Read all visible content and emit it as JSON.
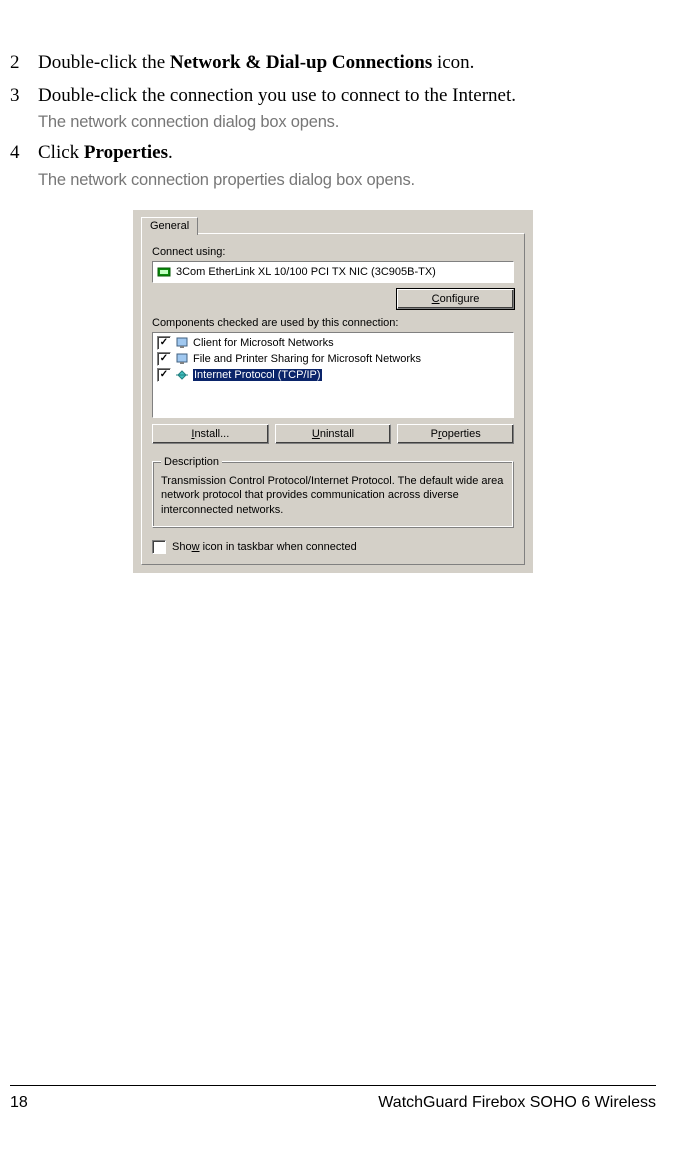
{
  "steps": [
    {
      "num": "2",
      "pre": "Double-click the ",
      "bold": "Network & Dial-up Connections",
      "post": " icon.",
      "result": ""
    },
    {
      "num": "3",
      "pre": "Double-click the connection you use to connect to the Internet.",
      "bold": "",
      "post": "",
      "result": "The network connection dialog box opens."
    },
    {
      "num": "4",
      "pre": "Click ",
      "bold": "Properties",
      "post": ".",
      "result": "The network connection properties dialog box opens."
    }
  ],
  "dialog": {
    "tab": "General",
    "connect_label": "Connect using:",
    "adapter": "3Com EtherLink XL 10/100 PCI TX NIC (3C905B-TX)",
    "configure_btn": "Configure",
    "components_label": "Components checked are used by this connection:",
    "components": [
      {
        "label": "Client for Microsoft Networks",
        "checked": true,
        "selected": false,
        "icon": "client"
      },
      {
        "label": "File and Printer Sharing for Microsoft Networks",
        "checked": true,
        "selected": false,
        "icon": "service"
      },
      {
        "label": "Internet Protocol (TCP/IP)",
        "checked": true,
        "selected": true,
        "icon": "protocol"
      }
    ],
    "install_btn": "Install...",
    "uninstall_btn": "Uninstall",
    "properties_btn": "Properties",
    "desc_legend": "Description",
    "desc_text": "Transmission Control Protocol/Internet Protocol. The default wide area network protocol that provides communication across diverse interconnected networks.",
    "show_icon": "Show icon in taskbar when connected"
  },
  "footer": {
    "page": "18",
    "title": "WatchGuard Firebox SOHO 6 Wireless"
  }
}
